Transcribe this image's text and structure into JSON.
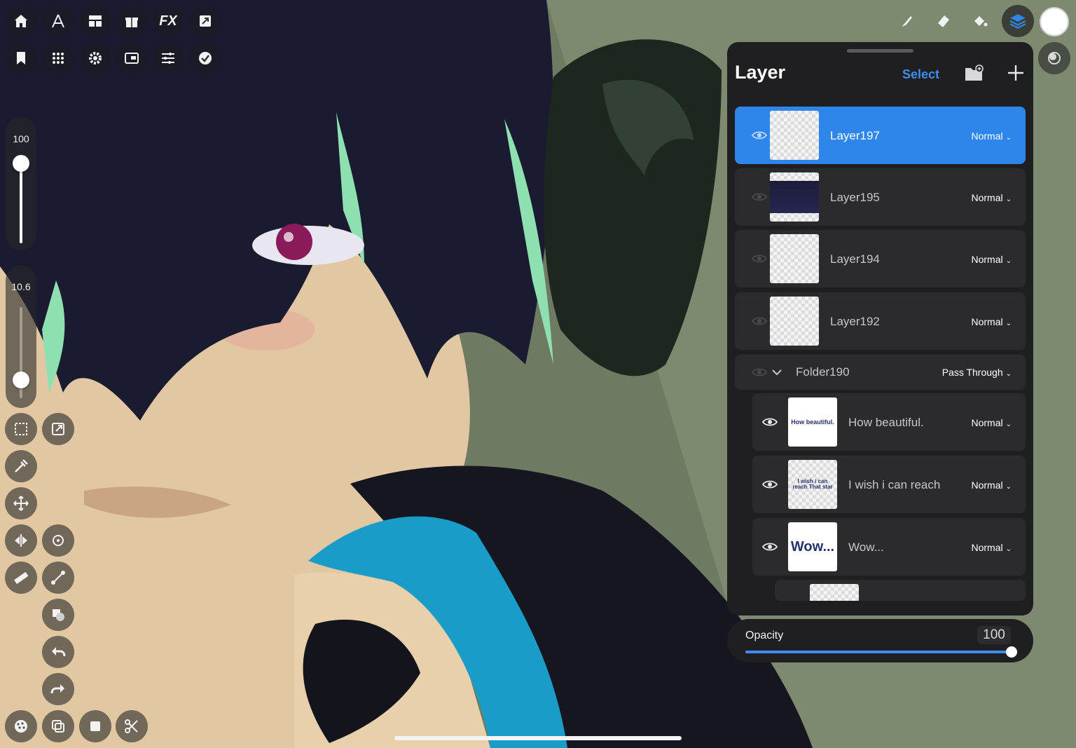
{
  "panel": {
    "title": "Layer",
    "select_label": "Select"
  },
  "layers": [
    {
      "name": "Layer197",
      "blend": "Normal"
    },
    {
      "name": "Layer195",
      "blend": "Normal"
    },
    {
      "name": "Layer194",
      "blend": "Normal"
    },
    {
      "name": "Layer192",
      "blend": "Normal"
    }
  ],
  "folder": {
    "name": "Folder190",
    "blend": "Pass Through"
  },
  "folder_layers": [
    {
      "name": "How beautiful.",
      "blend": "Normal",
      "thumb_text": "How beautiful."
    },
    {
      "name": "I wish i can reach",
      "blend": "Normal",
      "thumb_text": "I wish i can reach That star"
    },
    {
      "name": "Wow...",
      "blend": "Normal",
      "thumb_text": "Wow..."
    }
  ],
  "opacity": {
    "label": "Opacity",
    "value": "100",
    "fraction": 1.0
  },
  "brush_size": {
    "value": "100",
    "fraction": 1.0
  },
  "brush_opacity": {
    "value": "10.6",
    "fraction": 0.2
  },
  "colors": {
    "accent": "#2f86ea",
    "panel_bg": "#1f1f21",
    "row_bg": "#2b2b2e",
    "current_color": "#ffffff"
  },
  "icons": {
    "top_left_row1": [
      "home-icon",
      "text-icon",
      "layout-icon",
      "gift-icon",
      "fx-icon",
      "share-icon"
    ],
    "top_left_row2": [
      "bookmark-icon",
      "grid-icon",
      "gear-icon",
      "window-icon",
      "adjust-icon",
      "check-icon"
    ],
    "top_right": [
      "brush-icon",
      "eraser-icon",
      "fill-icon",
      "layers-icon",
      "color-icon"
    ]
  }
}
